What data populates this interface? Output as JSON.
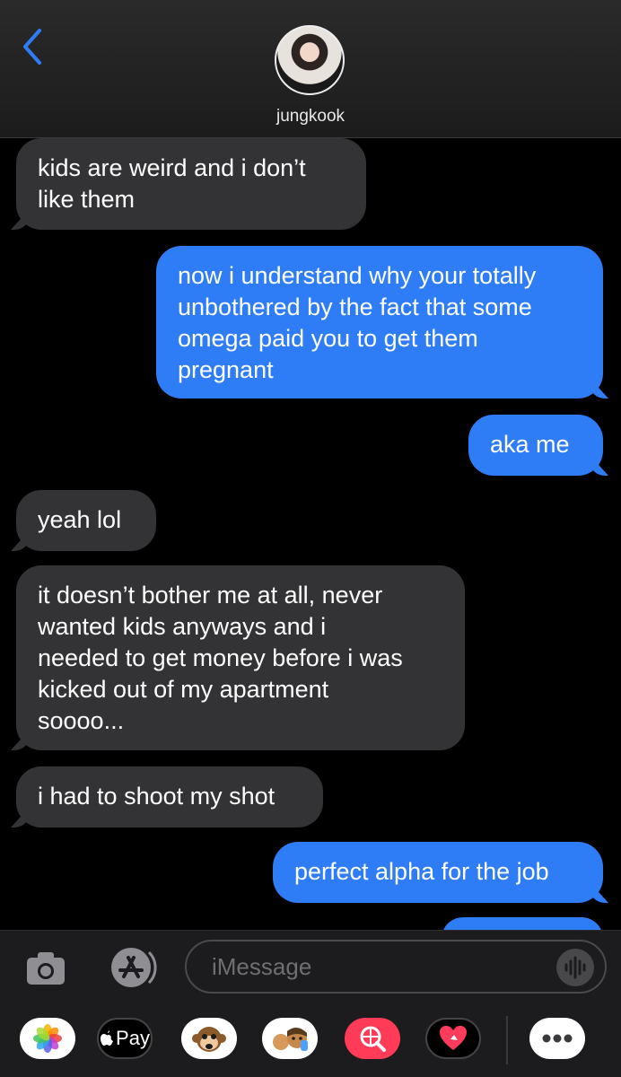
{
  "header": {
    "contact_name": "jungkook"
  },
  "messages": [
    {
      "side": "received",
      "text": "kids are weird and i don’t\nlike them"
    },
    {
      "side": "sent",
      "text": "now i understand why your totally\nunbothered by the fact that some\nomega paid you to get them\npregnant"
    },
    {
      "side": "sent",
      "text": "aka me"
    },
    {
      "side": "received",
      "text": "yeah lol"
    },
    {
      "side": "received",
      "text": "it doesn’t bother me at all, never\nwanted kids anyways and i\nneeded to get money before i was\nkicked out of my apartment\nsoooo..."
    },
    {
      "side": "received",
      "text": "i had to shoot my shot"
    },
    {
      "side": "sent",
      "text": "perfect alpha for the job"
    }
  ],
  "input": {
    "placeholder": "iMessage"
  },
  "apps": {
    "apple_pay_label": "Pay"
  },
  "colors": {
    "sent_bubble": "#2f7df6",
    "received_bubble": "#333335",
    "back_chevron": "#2f7df6"
  }
}
